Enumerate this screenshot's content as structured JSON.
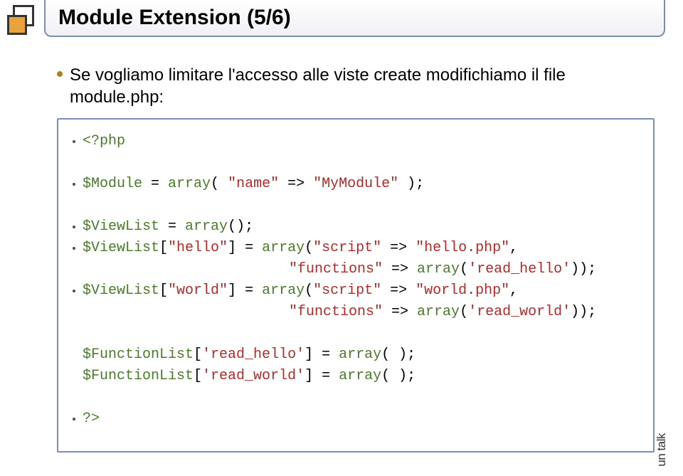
{
  "title": "Module Extension (5/6)",
  "bullet": "Se vogliamo limitare l'accesso alle viste create modifichiamo il file module.php:",
  "code": {
    "l1a": "<?php",
    "l2a": "$Module",
    "l2b": " = ",
    "l2c": "array",
    "l2d": "( ",
    "l2e": "\"name\"",
    "l2f": " => ",
    "l2g": "\"MyModule\"",
    "l2h": " );",
    "l3a": "$ViewList",
    "l3b": " = ",
    "l3c": "array",
    "l3d": "();",
    "l4a": "$ViewList",
    "l4b": "[",
    "l4c": "\"hello\"",
    "l4d": "] = ",
    "l4e": "array",
    "l4f": "(",
    "l4g": "\"script\"",
    "l4h": " => ",
    "l4i": "\"hello.php\"",
    "l4j": ",",
    "l5a": "\"functions\"",
    "l5b": " => ",
    "l5c": "array",
    "l5d": "(",
    "l5e": "'read_hello'",
    "l5f": "));",
    "l6a": "$ViewList",
    "l6b": "[",
    "l6c": "\"world\"",
    "l6d": "] = ",
    "l6e": "array",
    "l6f": "(",
    "l6g": "\"script\"",
    "l6h": " => ",
    "l6i": "\"world.php\"",
    "l6j": ",",
    "l7a": "\"functions\"",
    "l7b": " => ",
    "l7c": "array",
    "l7d": "(",
    "l7e": "'read_world'",
    "l7f": "));",
    "l8a": "$FunctionList",
    "l8b": "[",
    "l8c": "'read_hello'",
    "l8d": "] = ",
    "l8e": "array",
    "l8f": "( );",
    "l9a": "$FunctionList",
    "l9b": "[",
    "l9c": "'read_world'",
    "l9d": "] = ",
    "l9e": "array",
    "l9f": "( );",
    "l10a": "?>"
  },
  "footer": "un talk"
}
